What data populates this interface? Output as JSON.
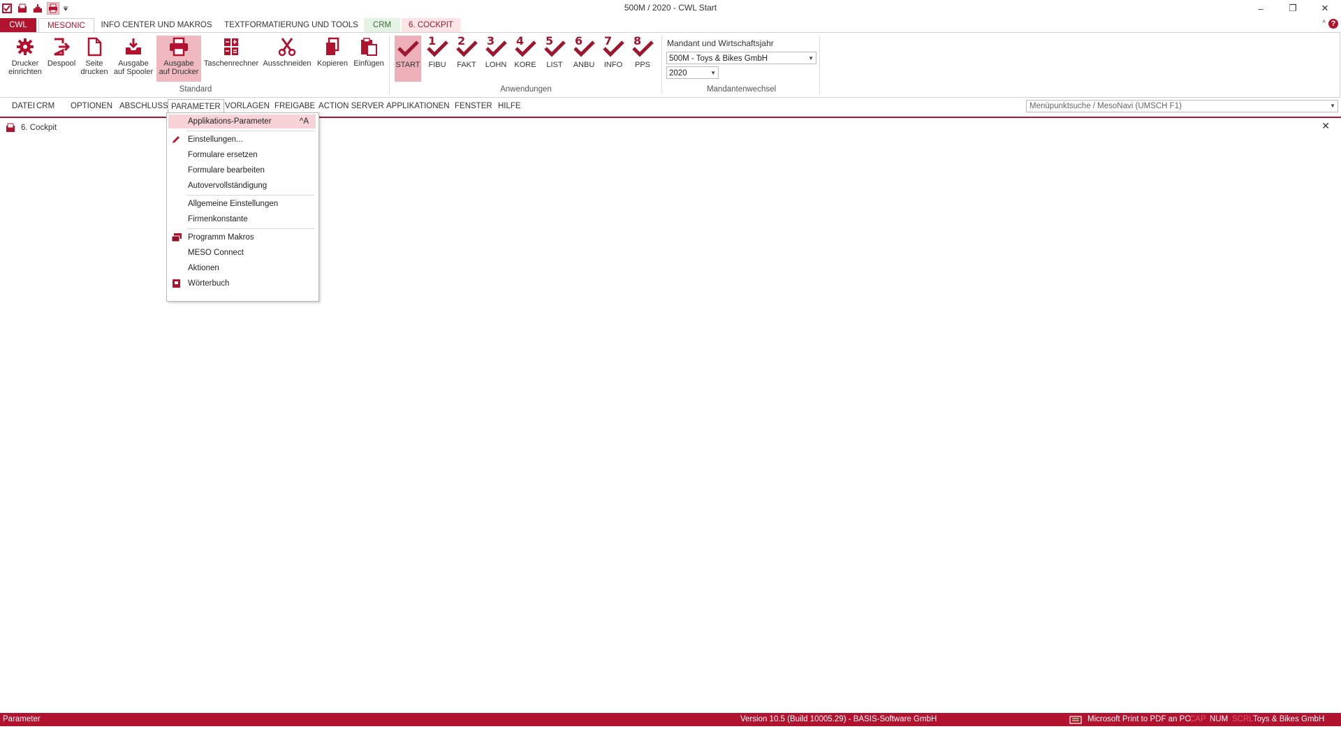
{
  "window": {
    "title": "500M / 2020 - CWL Start",
    "minimize": "–",
    "restore": "❐",
    "close": "✕"
  },
  "quick_access": [
    "app-icon",
    "cockpit-icon",
    "spool-icon",
    "printer-icon",
    "qat-dropdown"
  ],
  "ribbon_tabs": {
    "cwl": "CWL",
    "mesonic": "MESONIC",
    "info": "INFO CENTER UND MAKROS",
    "text": "TEXTFORMATIERUNG UND TOOLS",
    "crm": "CRM",
    "cockpit": "6. COCKPIT"
  },
  "ribbon": {
    "standard": {
      "label": "Standard",
      "buttons": [
        {
          "line1": "Drucker",
          "line2": "einrichten",
          "icon": "gear-icon"
        },
        {
          "line1": "Despool",
          "line2": "",
          "icon": "export-icon"
        },
        {
          "line1": "Seite",
          "line2": "drucken",
          "icon": "page-icon"
        },
        {
          "line1": "Ausgabe",
          "line2": "auf Spooler",
          "icon": "tray-icon"
        },
        {
          "line1": "Ausgabe",
          "line2": "auf Drucker",
          "icon": "printer-icon"
        },
        {
          "line1": "Taschenrechner",
          "line2": "",
          "icon": "calculator-icon"
        },
        {
          "line1": "Ausschneiden",
          "line2": "",
          "icon": "scissors-icon"
        },
        {
          "line1": "Kopieren",
          "line2": "",
          "icon": "copy-icon"
        },
        {
          "line1": "Einfügen",
          "line2": "",
          "icon": "paste-icon"
        }
      ]
    },
    "anwendungen": {
      "label": "Anwendungen",
      "apps": [
        {
          "num": "",
          "label": "START"
        },
        {
          "num": "1",
          "label": "FIBU"
        },
        {
          "num": "2",
          "label": "FAKT"
        },
        {
          "num": "3",
          "label": "LOHN"
        },
        {
          "num": "4",
          "label": "KORE"
        },
        {
          "num": "5",
          "label": "LIST"
        },
        {
          "num": "6",
          "label": "ANBU"
        },
        {
          "num": "7",
          "label": "INFO"
        },
        {
          "num": "8",
          "label": "PPS"
        }
      ]
    },
    "mandant": {
      "label": "Mandantenwechsel",
      "title": "Mandant und Wirtschaftsjahr",
      "company_value": "500M - Toys & Bikes GmbH",
      "year_value": "2020"
    }
  },
  "menubar": {
    "items": [
      "DATEI",
      "CRM",
      "OPTIONEN",
      "ABSCHLUSS",
      "PARAMETER",
      "VORLAGEN",
      "FREIGABE",
      "ACTION SERVER",
      "APPLIKATIONEN",
      "FENSTER",
      "HILFE"
    ],
    "search_placeholder": "Menüpunktsuche / MesoNavi (UMSCH F1)"
  },
  "document": {
    "title": "6. Cockpit"
  },
  "parameter_menu": {
    "items": [
      {
        "label": "Applikations-Parameter",
        "shortcut": "^A"
      },
      {
        "label": "Einstellungen..."
      },
      {
        "label": "Formulare ersetzen"
      },
      {
        "label": "Formulare bearbeiten"
      },
      {
        "label": "Autovervollständigung"
      },
      {
        "label": "Allgemeine Einstellungen"
      },
      {
        "label": "Firmenkonstante"
      },
      {
        "label": "Programm Makros"
      },
      {
        "label": "MESO Connect"
      },
      {
        "label": "Aktionen"
      },
      {
        "label": "Wörterbuch"
      }
    ]
  },
  "statusbar": {
    "left": "Parameter",
    "version": "Version 10.5 (Build 10005.29) - BASIS-Software GmbH",
    "printer": "Microsoft Print to PDF an PO",
    "cap": "CAP",
    "num": "NUM",
    "scrl": "SCRL",
    "company": "Toys & Bikes GmbH"
  },
  "colors": {
    "brand": "#b1122e",
    "highlight": "#f7d3d8"
  }
}
